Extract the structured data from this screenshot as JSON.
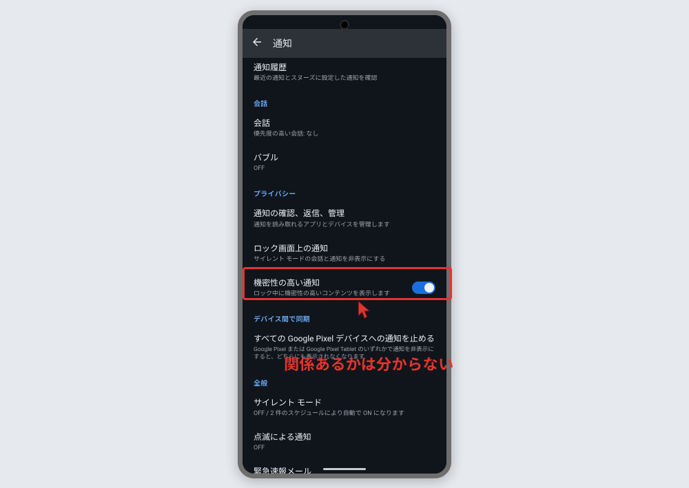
{
  "appbar": {
    "title": "通知"
  },
  "truncated_top": {
    "title": "通知履歴",
    "subtitle": "最近の通知とスヌーズに設定した通知を確認"
  },
  "section_conversation": {
    "header": "会話",
    "conversation": {
      "title": "会話",
      "subtitle": "優先度の高い会話: なし"
    },
    "bubble": {
      "title": "バブル",
      "subtitle": "OFF"
    }
  },
  "section_privacy": {
    "header": "プライバシー",
    "manage": {
      "title": "通知の確認、返信、管理",
      "subtitle": "通知を読み取れるアプリとデバイスを管理します"
    },
    "lockscreen": {
      "title": "ロック画面上の通知",
      "subtitle": "サイレント モードの会話と通知を非表示にする"
    },
    "sensitive": {
      "title": "機密性の高い通知",
      "subtitle": "ロック中に機密性の高いコンテンツを表示します",
      "switch_on": true
    }
  },
  "section_sync": {
    "header": "デバイス間で同期",
    "stop_all": {
      "title": "すべての Google Pixel デバイスへの通知を止める",
      "subtitle": "Google Pixel または Google Pixel Tablet のいずれかで通知を非表示にすると、どちらにも表示されなくなります"
    }
  },
  "section_general": {
    "header": "全般",
    "silent": {
      "title": "サイレント モード",
      "subtitle": "OFF / 2 件のスケジュールにより自動で ON になります"
    },
    "blink": {
      "title": "点滅による通知",
      "subtitle": "OFF"
    },
    "emergency": {
      "title": "緊急速報メール"
    }
  },
  "annotation": {
    "text": "関係あるかは分からない"
  }
}
